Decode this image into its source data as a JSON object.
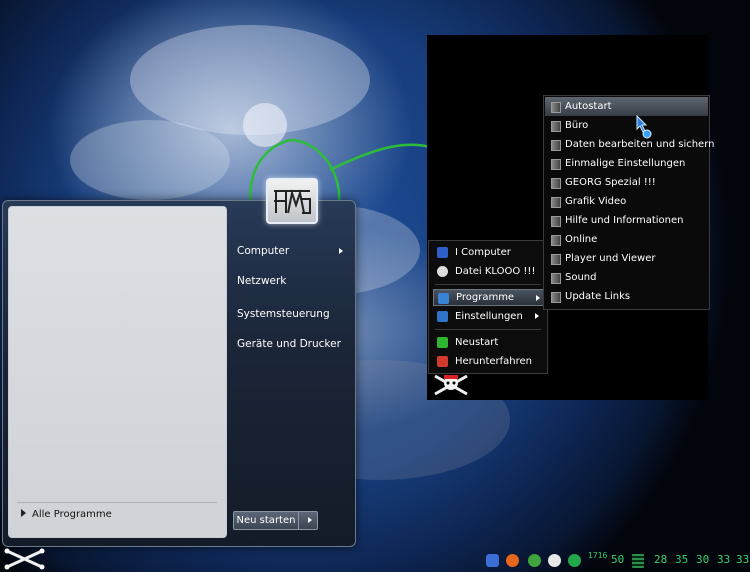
{
  "start_menu": {
    "right_items": [
      {
        "label": "Computer",
        "has_submenu": true
      },
      {
        "label": "Netzwerk"
      },
      {
        "label": "Systemsteuerung"
      },
      {
        "label": "Geräte und Drucker"
      }
    ],
    "all_programs_label": "Alle Programme",
    "shutdown_label": "Neu starten"
  },
  "popup_menu": {
    "items": [
      {
        "label": "I Computer",
        "icon": "computer-icon",
        "color": "#2d5fc8"
      },
      {
        "label": "Datei KLOOO !!!",
        "icon": "skull-icon",
        "color": "#dddddd"
      },
      {
        "label": "Programme",
        "icon": "programs-icon",
        "color": "#3a84d8",
        "has_submenu": true,
        "selected": true
      },
      {
        "label": "Einstellungen",
        "icon": "settings-icon",
        "color": "#2f73c9",
        "has_submenu": true
      },
      {
        "label": "Neustart",
        "icon": "restart-icon",
        "color": "#2fb52f"
      },
      {
        "label": "Herunterfahren",
        "icon": "shutdown-icon",
        "color": "#d33a2e"
      }
    ]
  },
  "submenu": {
    "items": [
      {
        "label": "Autostart",
        "selected": true
      },
      {
        "label": "Büro"
      },
      {
        "label": "Daten bearbeiten und sichern"
      },
      {
        "label": "Einmalige Einstellungen"
      },
      {
        "label": "GEORG Spezial !!!"
      },
      {
        "label": "Grafik Video"
      },
      {
        "label": "Hilfe und Informationen"
      },
      {
        "label": "Online"
      },
      {
        "label": "Player und Viewer"
      },
      {
        "label": "Sound"
      },
      {
        "label": "Update Links"
      }
    ]
  },
  "tray": {
    "clock": "1716",
    "values": [
      "50",
      "28",
      "35",
      "30",
      "33",
      "33"
    ],
    "accent": "#3cd070"
  }
}
